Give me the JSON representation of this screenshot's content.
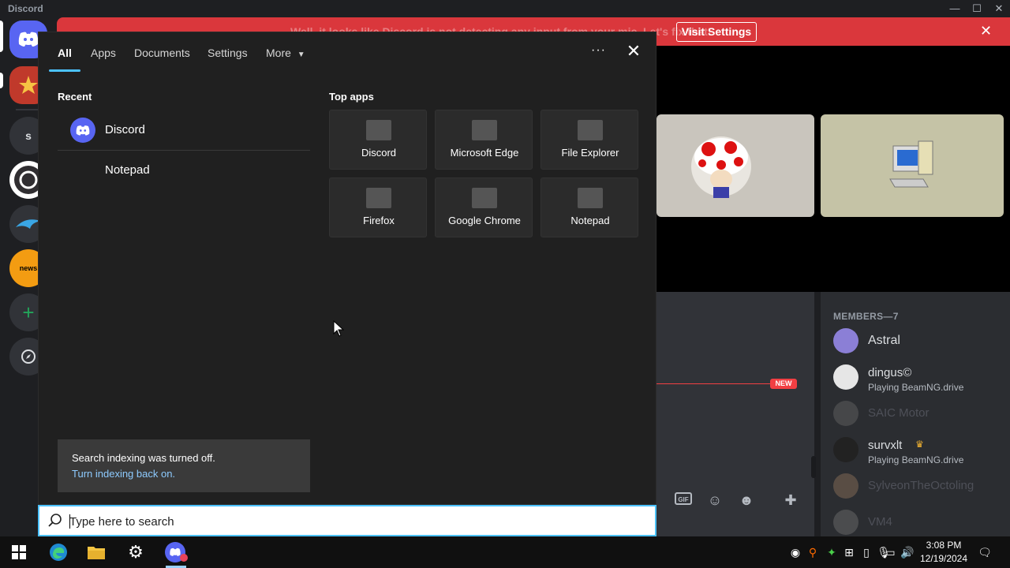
{
  "app": {
    "title": "Discord"
  },
  "discord": {
    "notice": {
      "text": "Well, it looks like Discord is not detecting any input from your mic. Let's fix that!",
      "button": "Visit Settings"
    },
    "servers": [
      {
        "label": "s"
      }
    ],
    "members": {
      "header": "MEMBERS—7",
      "list": [
        {
          "name": "Astral",
          "activity": ""
        },
        {
          "name": "dingus©",
          "activity": "Playing BeamNG.drive"
        },
        {
          "name": "SAIC Motor",
          "activity": ""
        },
        {
          "name": "survxlt",
          "activity": "Playing BeamNG.drive"
        },
        {
          "name": "SylveonTheOctoling",
          "activity": ""
        },
        {
          "name": "VM4",
          "activity": ""
        }
      ]
    },
    "new_badge": "NEW",
    "colors": {
      "notice": "#da373c",
      "blurple": "#5865f2"
    }
  },
  "search": {
    "tabs": [
      {
        "label": "All",
        "active": true
      },
      {
        "label": "Apps"
      },
      {
        "label": "Documents"
      },
      {
        "label": "Settings"
      },
      {
        "label": "More"
      }
    ],
    "recent_title": "Recent",
    "recent": [
      {
        "label": "Discord",
        "icon": "discord-icon"
      },
      {
        "label": "Notepad",
        "icon": ""
      }
    ],
    "top_apps_title": "Top apps",
    "top_apps": [
      {
        "label": "Discord"
      },
      {
        "label": "Microsoft Edge"
      },
      {
        "label": "File Explorer"
      },
      {
        "label": "Firefox"
      },
      {
        "label": "Google Chrome"
      },
      {
        "label": "Notepad"
      }
    ],
    "index_notice": {
      "line1": "Search indexing was turned off.",
      "line2": "Turn indexing back on."
    },
    "input": {
      "placeholder": "Type here to search",
      "value": ""
    },
    "accent": "#4cc2ff"
  },
  "taskbar": {
    "time": "3:08 PM",
    "date": "12/19/2024"
  }
}
